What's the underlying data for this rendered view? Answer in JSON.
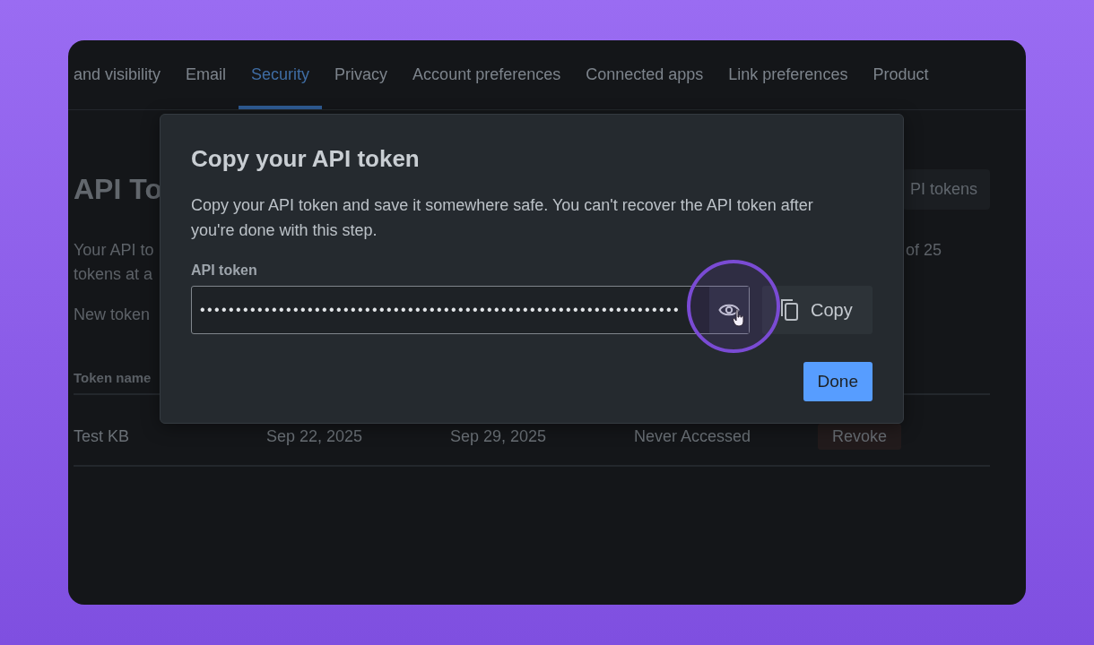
{
  "tabs": [
    {
      "label": "and visibility",
      "selected": false
    },
    {
      "label": "Email",
      "selected": false
    },
    {
      "label": "Security",
      "selected": true
    },
    {
      "label": "Privacy",
      "selected": false
    },
    {
      "label": "Account preferences",
      "selected": false
    },
    {
      "label": "Connected apps",
      "selected": false
    },
    {
      "label": "Link preferences",
      "selected": false
    },
    {
      "label": "Product",
      "selected": false
    }
  ],
  "page": {
    "heading": "API To",
    "action_button": "PI tokens",
    "intro_lines": [
      "Your API to",
      "tokens at a"
    ],
    "intro_right": "of 25",
    "new_token": "New token",
    "table": {
      "columns": [
        "Token name"
      ],
      "rows": [
        {
          "cells": [
            "Test KB",
            "Sep 22, 2025",
            "Sep 29, 2025",
            "Never Accessed"
          ],
          "action": "Revoke"
        }
      ]
    }
  },
  "modal": {
    "title": "Copy your API token",
    "description": "Copy your API token and save it somewhere safe. You can't recover the API token after you're done with this step.",
    "field_label": "API token",
    "value": "•••••••••••••••••••••••••••••••••••••••••••••••••••••••••••••••••••",
    "copy_button": "Copy",
    "done_button": "Done"
  }
}
